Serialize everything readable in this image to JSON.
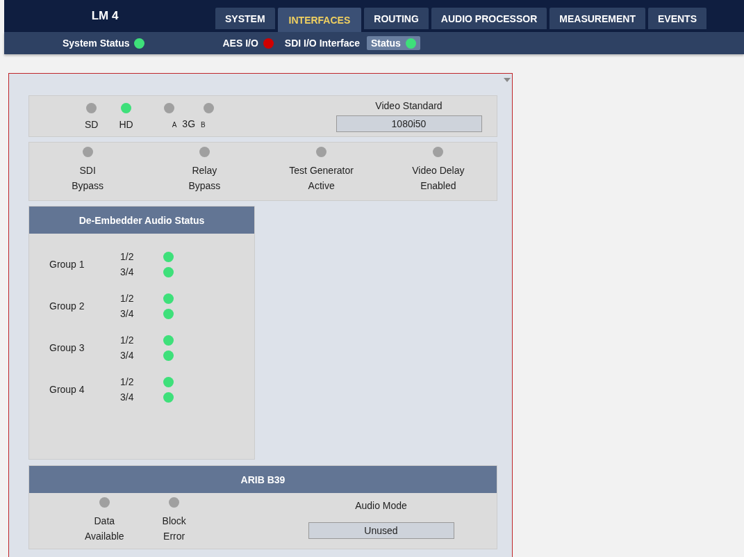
{
  "header": {
    "device": "LM 4",
    "tabs": [
      {
        "label": "SYSTEM",
        "selected": false
      },
      {
        "label": "INTERFACES",
        "selected": true
      },
      {
        "label": "ROUTING",
        "selected": false
      },
      {
        "label": "AUDIO PROCESSOR",
        "selected": false
      },
      {
        "label": "MEASUREMENT",
        "selected": false
      },
      {
        "label": "EVENTS",
        "selected": false
      }
    ]
  },
  "status_bar": {
    "items": [
      {
        "label": "System Status",
        "color": "#3ee07a",
        "selected": false
      },
      {
        "label": "AES I/O",
        "color": "#d00000",
        "selected": false
      },
      {
        "label": "SDI I/O Interface",
        "selected": false
      },
      {
        "label": "Status",
        "color": "#3ee07a",
        "selected": true
      }
    ]
  },
  "video": {
    "formats": [
      {
        "label": "SD",
        "color": "#a0a0a0"
      },
      {
        "label": "HD",
        "color": "#3ee07a"
      }
    ],
    "three_g": {
      "label": "3G",
      "leds": [
        {
          "label": "A",
          "color": "#a0a0a0"
        },
        {
          "label": "B",
          "color": "#a0a0a0"
        }
      ]
    },
    "video_standard": {
      "label": "Video Standard",
      "value": "1080i50"
    }
  },
  "flags": [
    {
      "lines": [
        "SDI",
        "Bypass"
      ],
      "color": "#a0a0a0"
    },
    {
      "lines": [
        "Relay",
        "Bypass"
      ],
      "color": "#a0a0a0"
    },
    {
      "lines": [
        "Test Generator",
        "Active"
      ],
      "color": "#a0a0a0"
    },
    {
      "lines": [
        "Video Delay",
        "Enabled"
      ],
      "color": "#a0a0a0"
    }
  ],
  "de_embedder": {
    "title": "De-Embedder Audio Status",
    "groups": [
      {
        "name": "Group 1",
        "pairs": [
          {
            "label": "1/2",
            "color": "#3ee07a"
          },
          {
            "label": "3/4",
            "color": "#3ee07a"
          }
        ]
      },
      {
        "name": "Group 2",
        "pairs": [
          {
            "label": "1/2",
            "color": "#3ee07a"
          },
          {
            "label": "3/4",
            "color": "#3ee07a"
          }
        ]
      },
      {
        "name": "Group 3",
        "pairs": [
          {
            "label": "1/2",
            "color": "#3ee07a"
          },
          {
            "label": "3/4",
            "color": "#3ee07a"
          }
        ]
      },
      {
        "name": "Group 4",
        "pairs": [
          {
            "label": "1/2",
            "color": "#3ee07a"
          },
          {
            "label": "3/4",
            "color": "#3ee07a"
          }
        ]
      }
    ]
  },
  "arib": {
    "title": "ARIB B39",
    "flags": [
      {
        "lines": [
          "Data",
          "Available"
        ],
        "color": "#a0a0a0"
      },
      {
        "lines": [
          "Block",
          "Error"
        ],
        "color": "#a0a0a0"
      }
    ],
    "audio_mode": {
      "label": "Audio Mode",
      "value": "Unused"
    }
  }
}
